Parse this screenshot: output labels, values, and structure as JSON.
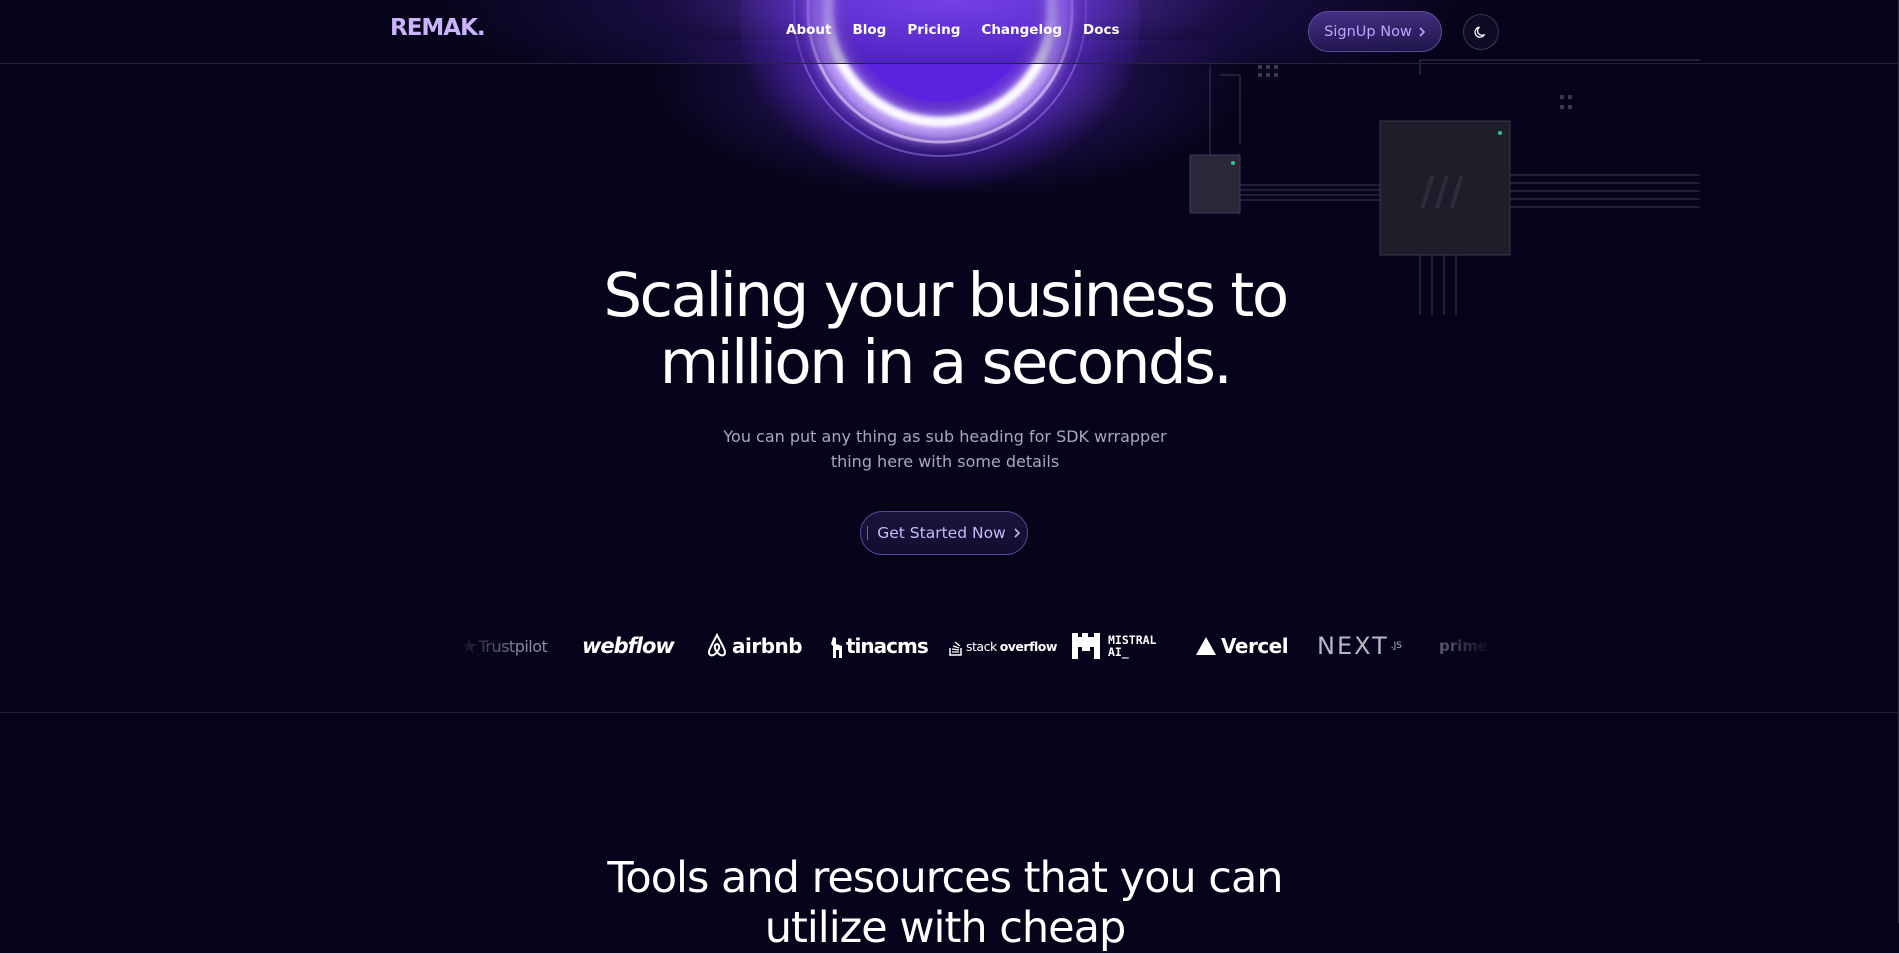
{
  "brand": {
    "logo": "REMAK."
  },
  "nav": {
    "links": [
      "About",
      "Blog",
      "Pricing",
      "Changelog",
      "Docs"
    ],
    "signup_label": "SignUp Now",
    "theme_toggle_icon": "moon-icon"
  },
  "hero": {
    "title_line1": "Scaling your business to",
    "title_line2": "million in a seconds.",
    "subtitle": "You can put any thing as sub heading for SDK wrrapper thing here with some details",
    "cta_label": "Get Started Now"
  },
  "logos": {
    "trustpilot": "Trustpilot",
    "webflow": "webflow",
    "airbnb": "airbnb",
    "tinacms": "tinacms",
    "stackoverflow_a": "stack",
    "stackoverflow_b": "overflow",
    "mistral_line1": "MISTRAL",
    "mistral_line2": "AI_",
    "vercel": "Vercel",
    "next": "NEXT",
    "next_suffix": ".JS",
    "prime": "prime"
  },
  "section": {
    "title": "Tools and resources that you can utilize with cheap"
  },
  "colors": {
    "background": "#06041a",
    "accent": "#7c4dff",
    "logo": "#cbb4ff",
    "button_text": "#b9a6ff"
  }
}
